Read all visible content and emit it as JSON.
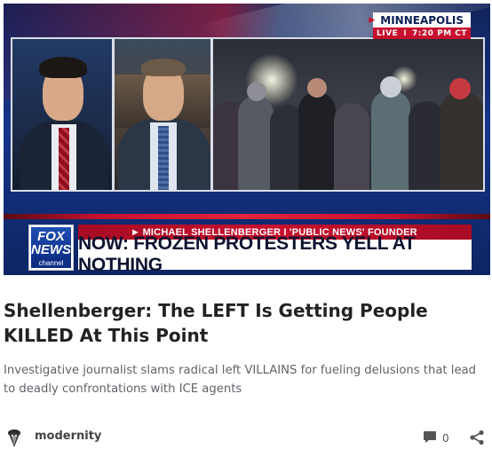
{
  "post": {
    "thumbnail": {
      "location": "MINNEAPOLIS",
      "live_label": "LIVE",
      "separator": "I",
      "time": "7:20 PM CT",
      "guest_caption": "MICHAEL SHELLENBERGER I 'PUBLIC NEWS' FOUNDER",
      "headline": "NOW: FROZEN PROTESTERS YELL AT NOTHING",
      "logo": {
        "line1": "FOX",
        "line2": "NEWS",
        "line3": "channel"
      },
      "colors": {
        "network_red": "#c8102e",
        "network_blue": "#0e2f86"
      }
    },
    "title": "Shellenberger: The LEFT Is Getting People KILLED At This Point",
    "subtitle": "Investigative journalist slams radical left VILLAINS for fueling delusions that lead to deadly confrontations with ICE agents",
    "author": "modernity",
    "comments_count": "0",
    "icons": {
      "avatar": "plague-doctor-avatar",
      "comment": "comment-bubble-icon",
      "share": "share-icon"
    }
  }
}
